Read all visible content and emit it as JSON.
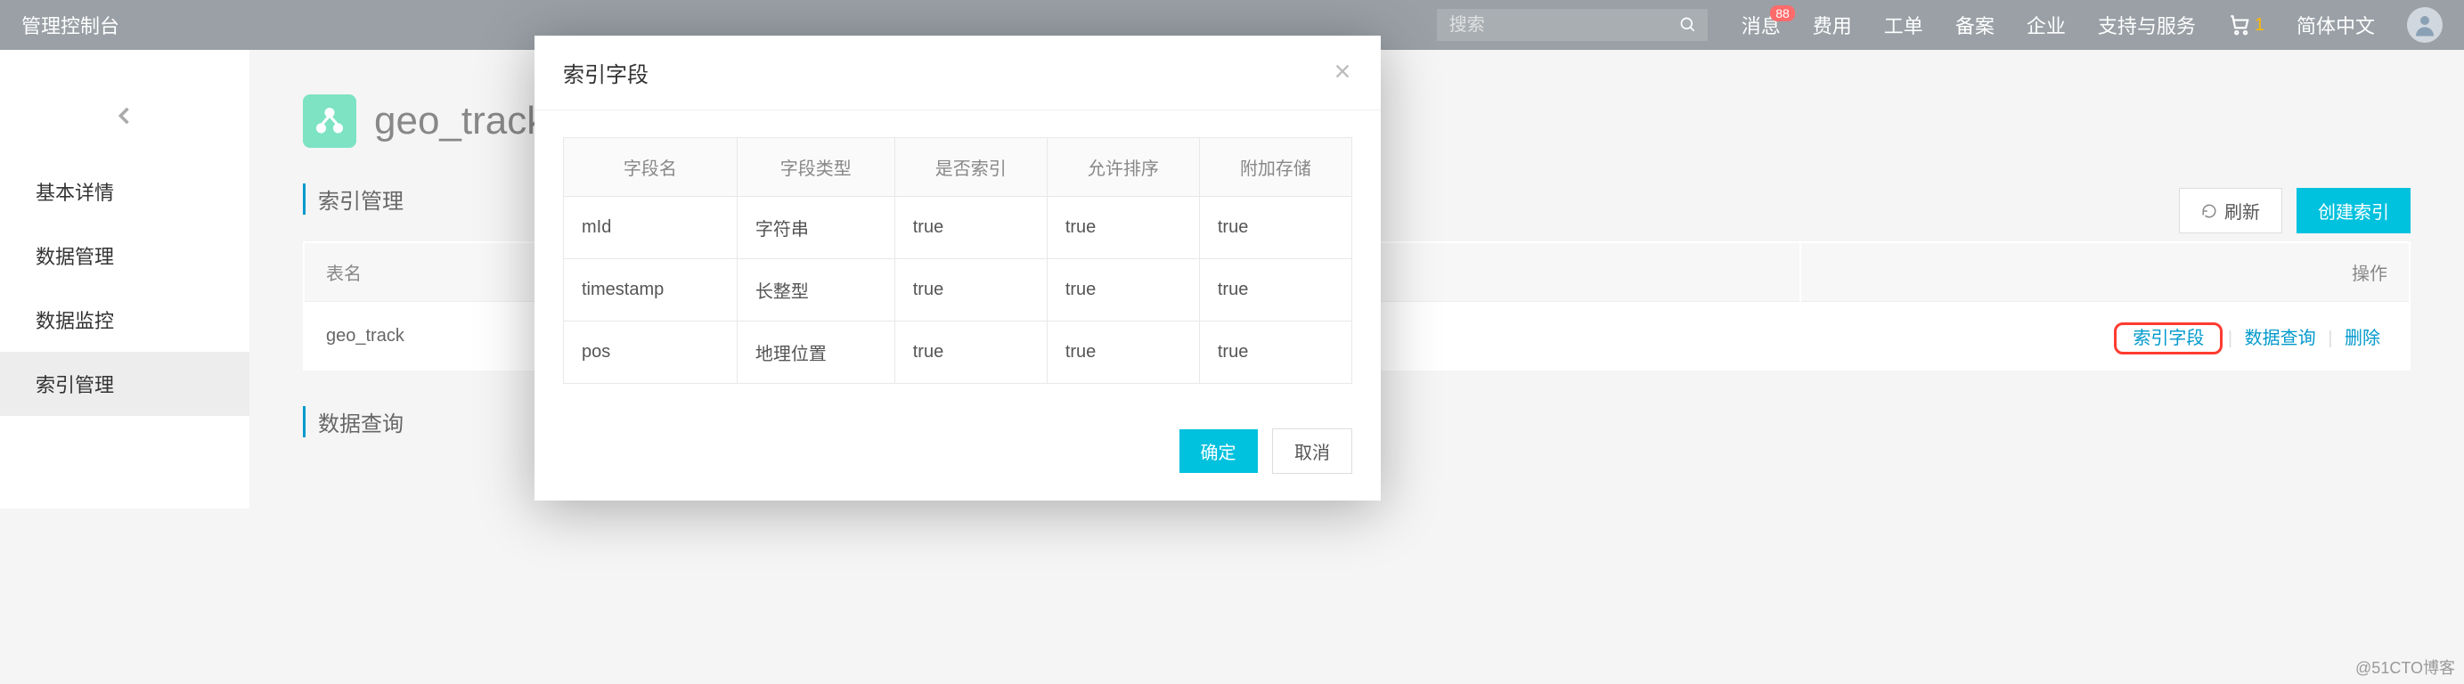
{
  "header": {
    "title": "管理控制台",
    "search_placeholder": "搜索",
    "nav": {
      "messages": "消息",
      "messages_badge": "88",
      "cost": "费用",
      "workorder": "工单",
      "beian": "备案",
      "enterprise": "企业",
      "support": "支持与服务",
      "cart_count": "1",
      "lang": "简体中文"
    }
  },
  "sidebar": {
    "items": [
      {
        "label": "基本详情"
      },
      {
        "label": "数据管理"
      },
      {
        "label": "数据监控"
      },
      {
        "label": "索引管理"
      }
    ]
  },
  "page": {
    "title": "geo_track",
    "section_index": "索引管理",
    "section_query": "数据查询",
    "refresh": "刷新",
    "create_index": "创建索引",
    "table": {
      "col_name": "表名",
      "col_ops": "操作",
      "row_name": "geo_track",
      "row_prefix": "g",
      "op_fields": "索引字段",
      "op_query": "数据查询",
      "op_delete": "删除"
    }
  },
  "modal": {
    "title": "索引字段",
    "cols": {
      "name": "字段名",
      "type": "字段类型",
      "is_index": "是否索引",
      "allow_sort": "允许排序",
      "extra_store": "附加存储"
    },
    "rows": [
      {
        "name": "mId",
        "type": "字符串",
        "is_index": "true",
        "allow_sort": "true",
        "extra_store": "true"
      },
      {
        "name": "timestamp",
        "type": "长整型",
        "is_index": "true",
        "allow_sort": "true",
        "extra_store": "true"
      },
      {
        "name": "pos",
        "type": "地理位置",
        "is_index": "true",
        "allow_sort": "true",
        "extra_store": "true"
      }
    ],
    "ok": "确定",
    "cancel": "取消"
  },
  "watermark": "@51CTO博客"
}
